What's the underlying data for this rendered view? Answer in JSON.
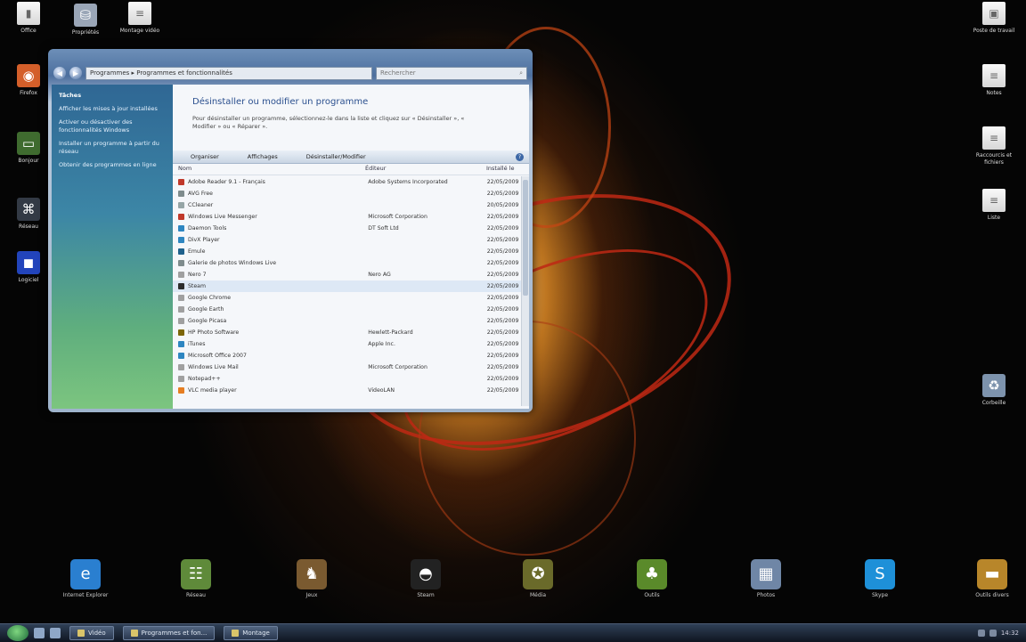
{
  "desktop_left": [
    {
      "name": "Offline-icon",
      "label": "Office",
      "glyph": "▮",
      "color": "#6aa84f",
      "doc": true
    },
    {
      "name": "browser-icon",
      "label": "Firefox",
      "glyph": "◉",
      "color": "#d45f2a"
    },
    {
      "name": "monitor-icon",
      "label": "Bonjour",
      "glyph": "▭",
      "color": "#3f6b2f"
    },
    {
      "name": "network-icon",
      "label": "Réseau",
      "glyph": "⌘",
      "color": "#333a45"
    },
    {
      "name": "app-icon",
      "label": "Logiciel",
      "glyph": "◼",
      "color": "#2244bb"
    }
  ],
  "desktop_top": [
    {
      "name": "folder-icon",
      "label": "Propriétés",
      "glyph": "⛁",
      "color": "#9aa6b7"
    },
    {
      "name": "document-icon",
      "label": "Montage vidéo",
      "glyph": "≡",
      "doc": true
    }
  ],
  "desktop_right": [
    {
      "name": "computer-icon",
      "label": "Poste de travail",
      "glyph": "▣",
      "doc": true
    },
    {
      "name": "document-icon",
      "label": "Notes",
      "glyph": "≡",
      "doc": true
    },
    {
      "name": "document-icon",
      "label": "Raccourcis et fichiers",
      "glyph": "≡",
      "doc": true
    },
    {
      "name": "document-icon",
      "label": "Liste",
      "glyph": "≡",
      "doc": true
    },
    {
      "name": "recycle-bin-icon",
      "label": "Corbeille",
      "glyph": "♻",
      "color": "#7d93ad"
    }
  ],
  "dock": [
    {
      "name": "internet-explorer-icon",
      "label": "Internet Explorer",
      "glyph": "e",
      "color": "#2a7fd0"
    },
    {
      "name": "network-map-icon",
      "label": "Réseau",
      "glyph": "☷",
      "color": "#5f8a3a"
    },
    {
      "name": "game-icon",
      "label": "Jeux",
      "glyph": "♞",
      "color": "#7a5a30"
    },
    {
      "name": "steam-icon",
      "label": "Steam",
      "glyph": "◓",
      "color": "#222"
    },
    {
      "name": "media-icon",
      "label": "Média",
      "glyph": "✪",
      "color": "#6a6a2a"
    },
    {
      "name": "android-icon",
      "label": "Outils",
      "glyph": "♣",
      "color": "#5a8a2a"
    },
    {
      "name": "photos-icon",
      "label": "Photos",
      "glyph": "▦",
      "color": "#6f86a6"
    },
    {
      "name": "skype-icon",
      "label": "Skype",
      "glyph": "S",
      "color": "#1e90d8"
    },
    {
      "name": "folder-tools-icon",
      "label": "Outils divers",
      "glyph": "▬",
      "color": "#b8862a"
    }
  ],
  "window": {
    "address": "Programmes ▸ Programmes et fonctionnalités",
    "search_placeholder": "Rechercher",
    "sidebar": {
      "title": "Tâches",
      "links": [
        "Afficher les mises à jour installées",
        "Activer ou désactiver des fonctionnalités Windows",
        "Installer un programme à partir du réseau",
        "Obtenir des programmes en ligne"
      ]
    },
    "heading": "Désinstaller ou modifier un programme",
    "description": "Pour désinstaller un programme, sélectionnez-le dans la liste et cliquez sur « Désinstaller », « Modifier » ou « Réparer ».",
    "toolbar": {
      "organize": "Organiser",
      "views": "Affichages",
      "uninstall": "Désinstaller/Modifier"
    },
    "columns": {
      "name": "Nom",
      "publisher": "Éditeur",
      "date": "Installé le"
    },
    "rows": [
      {
        "name": "Adobe Reader 9.1 - Français",
        "publisher": "Adobe Systems Incorporated",
        "date": "22/05/2009",
        "color": "#c0392b"
      },
      {
        "name": "AVG Free",
        "publisher": "",
        "date": "22/05/2009",
        "color": "#7f8c8d"
      },
      {
        "name": "CCleaner",
        "publisher": "",
        "date": "20/05/2009",
        "color": "#95a5a6"
      },
      {
        "name": "Windows Live Messenger",
        "publisher": "Microsoft Corporation",
        "date": "22/05/2009",
        "color": "#c0392b"
      },
      {
        "name": "Daemon Tools",
        "publisher": "DT Soft Ltd",
        "date": "22/05/2009",
        "color": "#2e86c1"
      },
      {
        "name": "DivX Player",
        "publisher": "",
        "date": "22/05/2009",
        "color": "#2e86c1"
      },
      {
        "name": "Emule",
        "publisher": "",
        "date": "22/05/2009",
        "color": "#1f618d"
      },
      {
        "name": "Galerie de photos Windows Live",
        "publisher": "",
        "date": "22/05/2009",
        "color": "#7f8c8d"
      },
      {
        "name": "Nero 7",
        "publisher": "Nero AG",
        "date": "22/05/2009",
        "color": "#a0a0a0"
      },
      {
        "name": "Steam",
        "publisher": "",
        "date": "22/05/2009",
        "color": "#2c2c2c"
      },
      {
        "name": "Google Chrome",
        "publisher": "",
        "date": "22/05/2009",
        "color": "#a0a0a0"
      },
      {
        "name": "Google Earth",
        "publisher": "",
        "date": "22/05/2009",
        "color": "#a0a0a0"
      },
      {
        "name": "Google Picasa",
        "publisher": "",
        "date": "22/05/2009",
        "color": "#a0a0a0"
      },
      {
        "name": "HP Photo Software",
        "publisher": "Hewlett-Packard",
        "date": "22/05/2009",
        "color": "#7d6608"
      },
      {
        "name": "iTunes",
        "publisher": "Apple Inc.",
        "date": "22/05/2009",
        "color": "#2e86c1"
      },
      {
        "name": "Microsoft Office 2007",
        "publisher": "",
        "date": "22/05/2009",
        "color": "#2e86c1"
      },
      {
        "name": "Windows Live Mail",
        "publisher": "Microsoft Corporation",
        "date": "22/05/2009",
        "color": "#a0a0a0"
      },
      {
        "name": "Notepad++",
        "publisher": "",
        "date": "22/05/2009",
        "color": "#a0a0a0"
      },
      {
        "name": "VLC media player",
        "publisher": "VideoLAN",
        "date": "22/05/2009",
        "color": "#e67e22"
      }
    ]
  },
  "taskbar": {
    "buttons": [
      {
        "label": "Vidéo"
      },
      {
        "label": "Programmes et fon..."
      },
      {
        "label": "Montage"
      }
    ],
    "clock": "14:32"
  }
}
